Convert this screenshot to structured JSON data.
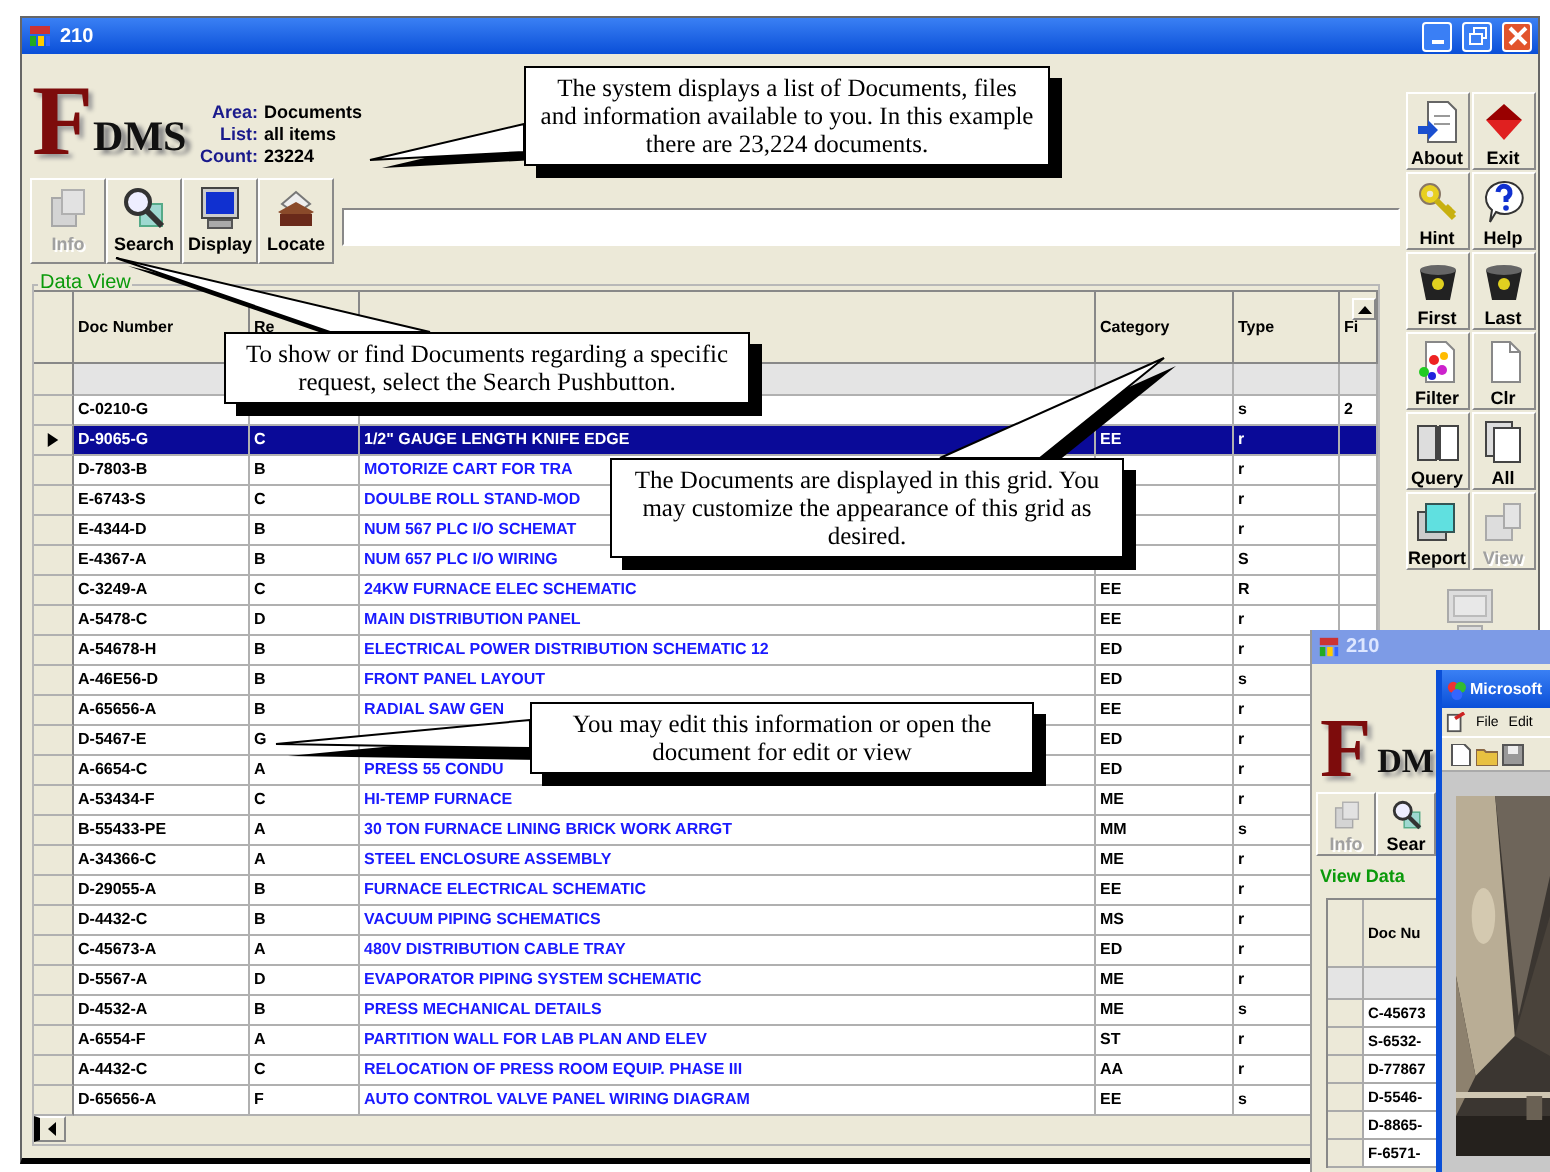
{
  "window": {
    "title": "210"
  },
  "logo": {
    "initial": "F",
    "rest": "DMS"
  },
  "info": [
    {
      "label": "Area:",
      "value": "Documents"
    },
    {
      "label": "List:",
      "value": "all items"
    },
    {
      "label": "Count:",
      "value": "23224"
    }
  ],
  "toolbar": [
    {
      "label": "Info",
      "disabled": true
    },
    {
      "label": "Search",
      "disabled": false
    },
    {
      "label": "Display",
      "disabled": false
    },
    {
      "label": "Locate",
      "disabled": false
    }
  ],
  "side_buttons": [
    {
      "label": "About",
      "disabled": false
    },
    {
      "label": "Exit",
      "disabled": false
    },
    {
      "label": "Hint",
      "disabled": false
    },
    {
      "label": "Help",
      "disabled": false
    },
    {
      "label": "First",
      "disabled": false
    },
    {
      "label": "Last",
      "disabled": false
    },
    {
      "label": "Filter",
      "disabled": false
    },
    {
      "label": "Clr",
      "disabled": false
    },
    {
      "label": "Query",
      "disabled": false
    },
    {
      "label": "All",
      "disabled": false
    },
    {
      "label": "Report",
      "disabled": false
    },
    {
      "label": "View",
      "disabled": true
    }
  ],
  "data_view": {
    "legend": "Data View",
    "columns": [
      {
        "kind": "doc",
        "label": "Doc Number"
      },
      {
        "kind": "rev",
        "label": "Re"
      },
      {
        "kind": "title"
      },
      {
        "kind": "category",
        "label": "Category"
      },
      {
        "kind": "type",
        "label": "Type"
      },
      {
        "kind": "fi",
        "label": "Fi"
      }
    ],
    "rows": [
      {
        "doc": "C-0210-G",
        "type": "s",
        "fi": "2",
        "selected": false
      },
      {
        "doc": "D-9065-G",
        "rev": "C",
        "title": "1/2\" GAUGE LENGTH KNIFE EDGE",
        "category": "EE",
        "type": "r",
        "selected": true
      },
      {
        "doc": "D-7803-B",
        "rev": "B",
        "title": "MOTORIZE CART FOR TRA",
        "type": "r",
        "selected": false
      },
      {
        "doc": "E-6743-S",
        "rev": "C",
        "title": "DOULBE ROLL STAND-MOD",
        "type": "r",
        "selected": false
      },
      {
        "doc": "E-4344-D",
        "rev": "B",
        "title": "NUM 567 PLC I/O SCHEMAT",
        "type": "r",
        "selected": false
      },
      {
        "doc": "E-4367-A",
        "rev": "B",
        "title": "NUM 657 PLC I/O WIRING",
        "type": "S",
        "selected": false
      },
      {
        "doc": "C-3249-A",
        "rev": "C",
        "title": "24KW FURNACE ELEC SCHEMATIC",
        "category": "EE",
        "type": "R",
        "selected": false
      },
      {
        "doc": "A-5478-C",
        "rev": "D",
        "title": "MAIN DISTRIBUTION PANEL",
        "category": "EE",
        "type": "r",
        "selected": false
      },
      {
        "doc": "A-54678-H",
        "rev": "B",
        "title": "ELECTRICAL POWER DISTRIBUTION SCHEMATIC 12",
        "category": "ED",
        "type": "r",
        "selected": false
      },
      {
        "doc": "A-46E56-D",
        "rev": "B",
        "title": "FRONT PANEL LAYOUT",
        "category": "ED",
        "type": "s",
        "selected": false
      },
      {
        "doc": "A-65656-A",
        "rev": "B",
        "title": "RADIAL SAW GEN",
        "category": "EE",
        "type": "r",
        "selected": false
      },
      {
        "doc": "D-5467-E",
        "rev": "G",
        "category": "ED",
        "type": "r",
        "selected": false
      },
      {
        "doc": "A-6654-C",
        "rev": "A",
        "title": "PRESS 55 CONDU",
        "category": "ED",
        "type": "r",
        "selected": false
      },
      {
        "doc": "A-53434-F",
        "rev": "C",
        "title": "HI-TEMP FURNACE",
        "category": "ME",
        "type": "r",
        "selected": false
      },
      {
        "doc": "B-55433-PE",
        "rev": "A",
        "title": "30 TON FURNACE LINING BRICK WORK ARRGT",
        "category": "MM",
        "type": "s",
        "selected": false
      },
      {
        "doc": "A-34366-C",
        "rev": "A",
        "title": "STEEL ENCLOSURE ASSEMBLY",
        "category": "ME",
        "type": "r",
        "selected": false
      },
      {
        "doc": "D-29055-A",
        "rev": "B",
        "title": "FURNACE ELECTRICAL SCHEMATIC",
        "category": "EE",
        "type": "r",
        "selected": false
      },
      {
        "doc": "D-4432-C",
        "rev": "B",
        "title": "VACUUM PIPING SCHEMATICS",
        "category": "MS",
        "type": "r",
        "selected": false
      },
      {
        "doc": "C-45673-A",
        "rev": "A",
        "title": "480V DISTRIBUTION CABLE TRAY",
        "category": "ED",
        "type": "r",
        "selected": false
      },
      {
        "doc": "D-5567-A",
        "rev": "D",
        "title": "EVAPORATOR PIPING SYSTEM SCHEMATIC",
        "category": "ME",
        "type": "r",
        "selected": false
      },
      {
        "doc": "D-4532-A",
        "rev": "B",
        "title": "PRESS MECHANICAL DETAILS",
        "category": "ME",
        "type": "s",
        "selected": false
      },
      {
        "doc": "A-6554-F",
        "rev": "A",
        "title": "PARTITION WALL FOR LAB PLAN AND ELEV",
        "category": "ST",
        "type": "r",
        "selected": false
      },
      {
        "doc": "A-4432-C",
        "rev": "C",
        "title": "RELOCATION OF PRESS ROOM EQUIP. PHASE III",
        "category": "AA",
        "type": "r",
        "selected": false
      },
      {
        "doc": "D-65656-A",
        "rev": "F",
        "title": "AUTO CONTROL VALVE PANEL WIRING DIAGRAM",
        "category": "EE",
        "type": "s",
        "selected": false
      }
    ]
  },
  "background_window": {
    "title": "210",
    "logo": {
      "initial": "F",
      "rest": "DM"
    },
    "toolbar": [
      {
        "label": "Info",
        "disabled": true
      },
      {
        "label": "Sear",
        "disabled": false
      }
    ],
    "legend": "View Data",
    "column": "Doc Nu",
    "rows": [
      "C-45673",
      "S-6532-",
      "D-77867",
      "D-5546-",
      "D-8865-",
      "F-6571-"
    ]
  },
  "front_window": {
    "title": "Microsoft",
    "menu": [
      "File",
      "Edit"
    ]
  },
  "callouts": [
    {
      "text": "The system displays a list of Documents, files and information available to you. In this example there are 23,224 documents."
    },
    {
      "text": "To show or find Documents regarding a specific request, select the Search Pushbutton."
    },
    {
      "text": "The Documents are displayed in this grid. You may customize the appearance of this grid as desired."
    },
    {
      "text": "You may edit this information or open the document for edit or view"
    }
  ]
}
